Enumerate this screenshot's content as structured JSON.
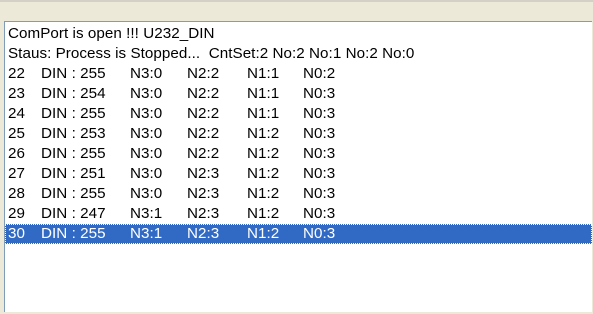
{
  "window": {
    "status_lines": [
      "ComPort is open !!! U232_DIN",
      "Staus: Process is Stopped...  CntSet:2 No:2 No:1 No:2 No:0"
    ],
    "log_rows": [
      {
        "id": "22",
        "din": "DIN : 255",
        "n3": "N3:0",
        "n2": "N2:2",
        "n1": "N1:1",
        "n0": "N0:2"
      },
      {
        "id": "23",
        "din": "DIN : 254",
        "n3": "N3:0",
        "n2": "N2:2",
        "n1": "N1:1",
        "n0": "N0:3"
      },
      {
        "id": "24",
        "din": "DIN : 255",
        "n3": "N3:0",
        "n2": "N2:2",
        "n1": "N1:1",
        "n0": "N0:3"
      },
      {
        "id": "25",
        "din": "DIN : 253",
        "n3": "N3:0",
        "n2": "N2:2",
        "n1": "N1:2",
        "n0": "N0:3"
      },
      {
        "id": "26",
        "din": "DIN : 255",
        "n3": "N3:0",
        "n2": "N2:2",
        "n1": "N1:2",
        "n0": "N0:3"
      },
      {
        "id": "27",
        "din": "DIN : 251",
        "n3": "N3:0",
        "n2": "N2:3",
        "n1": "N1:2",
        "n0": "N0:3"
      },
      {
        "id": "28",
        "din": "DIN : 255",
        "n3": "N3:0",
        "n2": "N2:3",
        "n1": "N1:2",
        "n0": "N0:3"
      },
      {
        "id": "29",
        "din": "DIN : 247",
        "n3": "N3:1",
        "n2": "N2:3",
        "n1": "N1:2",
        "n0": "N0:3"
      },
      {
        "id": "30",
        "din": "DIN : 255",
        "n3": "N3:1",
        "n2": "N2:3",
        "n1": "N1:2",
        "n0": "N0:3"
      }
    ],
    "selected_row": "30"
  }
}
